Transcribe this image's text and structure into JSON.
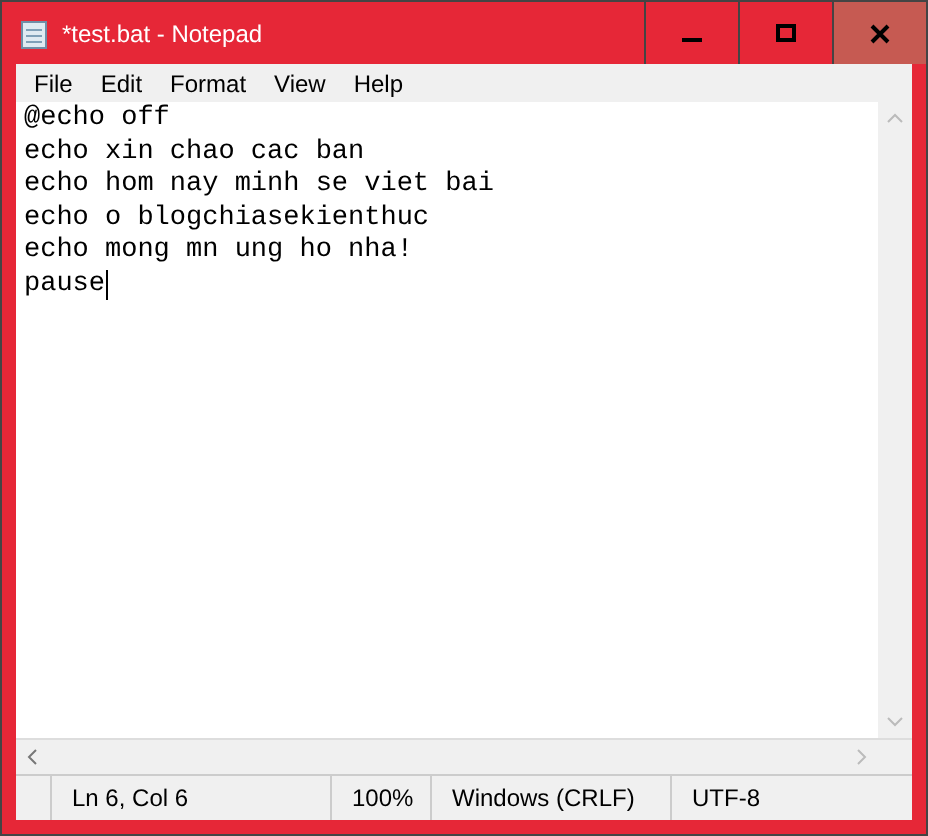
{
  "window": {
    "title": "*test.bat - Notepad",
    "controls": [
      {
        "kind": "minimize"
      },
      {
        "kind": "maximize"
      },
      {
        "kind": "close"
      }
    ]
  },
  "menu": [
    "File",
    "Edit",
    "Format",
    "View",
    "Help"
  ],
  "editor": {
    "lines": [
      "@echo off",
      "echo xin chao cac ban",
      "echo hom nay minh se viet bai",
      "echo o blogchiasekienthuc",
      "echo mong mn ung ho nha!",
      "pause"
    ]
  },
  "status_bar": [
    "Ln 6, Col 6",
    "100%",
    "Windows (CRLF)",
    "UTF-8"
  ]
}
